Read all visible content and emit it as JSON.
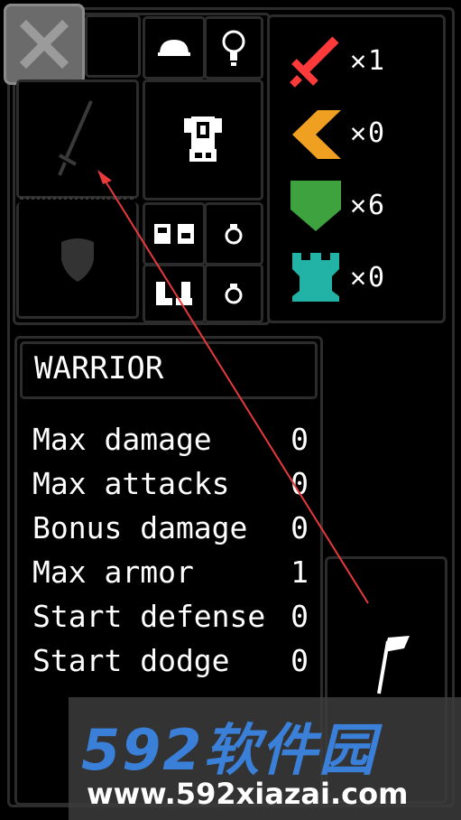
{
  "close_button": {
    "icon": "close-icon"
  },
  "equipment": {
    "weapon_icon": "sword-icon",
    "offhand_icon": "shield-icon",
    "head_icon": "helmet-icon",
    "amulet_icon": "lightbulb-icon",
    "body_icon": "armor-icon",
    "gloves_icon": "gloves-icon",
    "boots_icon": "boots-icon",
    "ring1_icon": "ring-icon",
    "ring2_icon": "ring-icon"
  },
  "counters": [
    {
      "icon": "red-sword-icon",
      "color": "#ff3a3a",
      "label": "✕1"
    },
    {
      "icon": "orange-chevron-icon",
      "color": "#f0a020",
      "label": "✕0"
    },
    {
      "icon": "green-shield-icon",
      "color": "#3ea33e",
      "label": "✕6"
    },
    {
      "icon": "teal-tower-icon",
      "color": "#22b2a6",
      "label": "✕0"
    }
  ],
  "character": {
    "class_name": "WARRIOR",
    "stats": [
      {
        "label": "Max damage",
        "value": "0"
      },
      {
        "label": "Max attacks",
        "value": "0"
      },
      {
        "label": "Bonus damage",
        "value": "0"
      },
      {
        "label": "Max armor",
        "value": "1"
      },
      {
        "label": "Start defense",
        "value": "0"
      },
      {
        "label": "Start dodge",
        "value": "0"
      }
    ]
  },
  "watermark": {
    "brand": "592软件园",
    "url": "www.592xiazai.com"
  }
}
